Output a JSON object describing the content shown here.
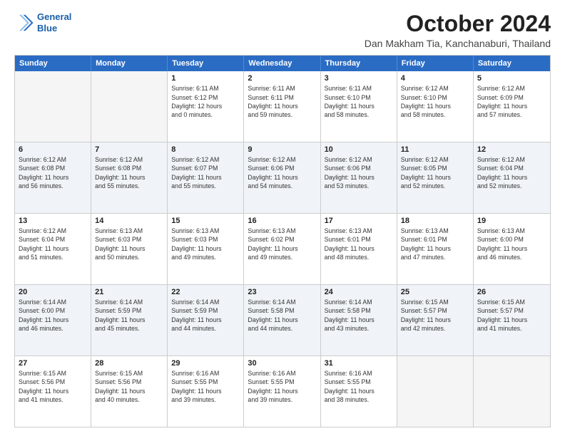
{
  "logo": {
    "line1": "General",
    "line2": "Blue"
  },
  "title": "October 2024",
  "location": "Dan Makham Tia, Kanchanaburi, Thailand",
  "header_days": [
    "Sunday",
    "Monday",
    "Tuesday",
    "Wednesday",
    "Thursday",
    "Friday",
    "Saturday"
  ],
  "weeks": [
    [
      {
        "day": "",
        "info": "",
        "empty": true
      },
      {
        "day": "",
        "info": "",
        "empty": true
      },
      {
        "day": "1",
        "info": "Sunrise: 6:11 AM\nSunset: 6:12 PM\nDaylight: 12 hours\nand 0 minutes.",
        "empty": false
      },
      {
        "day": "2",
        "info": "Sunrise: 6:11 AM\nSunset: 6:11 PM\nDaylight: 11 hours\nand 59 minutes.",
        "empty": false
      },
      {
        "day": "3",
        "info": "Sunrise: 6:11 AM\nSunset: 6:10 PM\nDaylight: 11 hours\nand 58 minutes.",
        "empty": false
      },
      {
        "day": "4",
        "info": "Sunrise: 6:12 AM\nSunset: 6:10 PM\nDaylight: 11 hours\nand 58 minutes.",
        "empty": false
      },
      {
        "day": "5",
        "info": "Sunrise: 6:12 AM\nSunset: 6:09 PM\nDaylight: 11 hours\nand 57 minutes.",
        "empty": false
      }
    ],
    [
      {
        "day": "6",
        "info": "Sunrise: 6:12 AM\nSunset: 6:08 PM\nDaylight: 11 hours\nand 56 minutes.",
        "empty": false
      },
      {
        "day": "7",
        "info": "Sunrise: 6:12 AM\nSunset: 6:08 PM\nDaylight: 11 hours\nand 55 minutes.",
        "empty": false
      },
      {
        "day": "8",
        "info": "Sunrise: 6:12 AM\nSunset: 6:07 PM\nDaylight: 11 hours\nand 55 minutes.",
        "empty": false
      },
      {
        "day": "9",
        "info": "Sunrise: 6:12 AM\nSunset: 6:06 PM\nDaylight: 11 hours\nand 54 minutes.",
        "empty": false
      },
      {
        "day": "10",
        "info": "Sunrise: 6:12 AM\nSunset: 6:06 PM\nDaylight: 11 hours\nand 53 minutes.",
        "empty": false
      },
      {
        "day": "11",
        "info": "Sunrise: 6:12 AM\nSunset: 6:05 PM\nDaylight: 11 hours\nand 52 minutes.",
        "empty": false
      },
      {
        "day": "12",
        "info": "Sunrise: 6:12 AM\nSunset: 6:04 PM\nDaylight: 11 hours\nand 52 minutes.",
        "empty": false
      }
    ],
    [
      {
        "day": "13",
        "info": "Sunrise: 6:12 AM\nSunset: 6:04 PM\nDaylight: 11 hours\nand 51 minutes.",
        "empty": false
      },
      {
        "day": "14",
        "info": "Sunrise: 6:13 AM\nSunset: 6:03 PM\nDaylight: 11 hours\nand 50 minutes.",
        "empty": false
      },
      {
        "day": "15",
        "info": "Sunrise: 6:13 AM\nSunset: 6:03 PM\nDaylight: 11 hours\nand 49 minutes.",
        "empty": false
      },
      {
        "day": "16",
        "info": "Sunrise: 6:13 AM\nSunset: 6:02 PM\nDaylight: 11 hours\nand 49 minutes.",
        "empty": false
      },
      {
        "day": "17",
        "info": "Sunrise: 6:13 AM\nSunset: 6:01 PM\nDaylight: 11 hours\nand 48 minutes.",
        "empty": false
      },
      {
        "day": "18",
        "info": "Sunrise: 6:13 AM\nSunset: 6:01 PM\nDaylight: 11 hours\nand 47 minutes.",
        "empty": false
      },
      {
        "day": "19",
        "info": "Sunrise: 6:13 AM\nSunset: 6:00 PM\nDaylight: 11 hours\nand 46 minutes.",
        "empty": false
      }
    ],
    [
      {
        "day": "20",
        "info": "Sunrise: 6:14 AM\nSunset: 6:00 PM\nDaylight: 11 hours\nand 46 minutes.",
        "empty": false
      },
      {
        "day": "21",
        "info": "Sunrise: 6:14 AM\nSunset: 5:59 PM\nDaylight: 11 hours\nand 45 minutes.",
        "empty": false
      },
      {
        "day": "22",
        "info": "Sunrise: 6:14 AM\nSunset: 5:59 PM\nDaylight: 11 hours\nand 44 minutes.",
        "empty": false
      },
      {
        "day": "23",
        "info": "Sunrise: 6:14 AM\nSunset: 5:58 PM\nDaylight: 11 hours\nand 44 minutes.",
        "empty": false
      },
      {
        "day": "24",
        "info": "Sunrise: 6:14 AM\nSunset: 5:58 PM\nDaylight: 11 hours\nand 43 minutes.",
        "empty": false
      },
      {
        "day": "25",
        "info": "Sunrise: 6:15 AM\nSunset: 5:57 PM\nDaylight: 11 hours\nand 42 minutes.",
        "empty": false
      },
      {
        "day": "26",
        "info": "Sunrise: 6:15 AM\nSunset: 5:57 PM\nDaylight: 11 hours\nand 41 minutes.",
        "empty": false
      }
    ],
    [
      {
        "day": "27",
        "info": "Sunrise: 6:15 AM\nSunset: 5:56 PM\nDaylight: 11 hours\nand 41 minutes.",
        "empty": false
      },
      {
        "day": "28",
        "info": "Sunrise: 6:15 AM\nSunset: 5:56 PM\nDaylight: 11 hours\nand 40 minutes.",
        "empty": false
      },
      {
        "day": "29",
        "info": "Sunrise: 6:16 AM\nSunset: 5:55 PM\nDaylight: 11 hours\nand 39 minutes.",
        "empty": false
      },
      {
        "day": "30",
        "info": "Sunrise: 6:16 AM\nSunset: 5:55 PM\nDaylight: 11 hours\nand 39 minutes.",
        "empty": false
      },
      {
        "day": "31",
        "info": "Sunrise: 6:16 AM\nSunset: 5:55 PM\nDaylight: 11 hours\nand 38 minutes.",
        "empty": false
      },
      {
        "day": "",
        "info": "",
        "empty": true
      },
      {
        "day": "",
        "info": "",
        "empty": true
      }
    ]
  ]
}
